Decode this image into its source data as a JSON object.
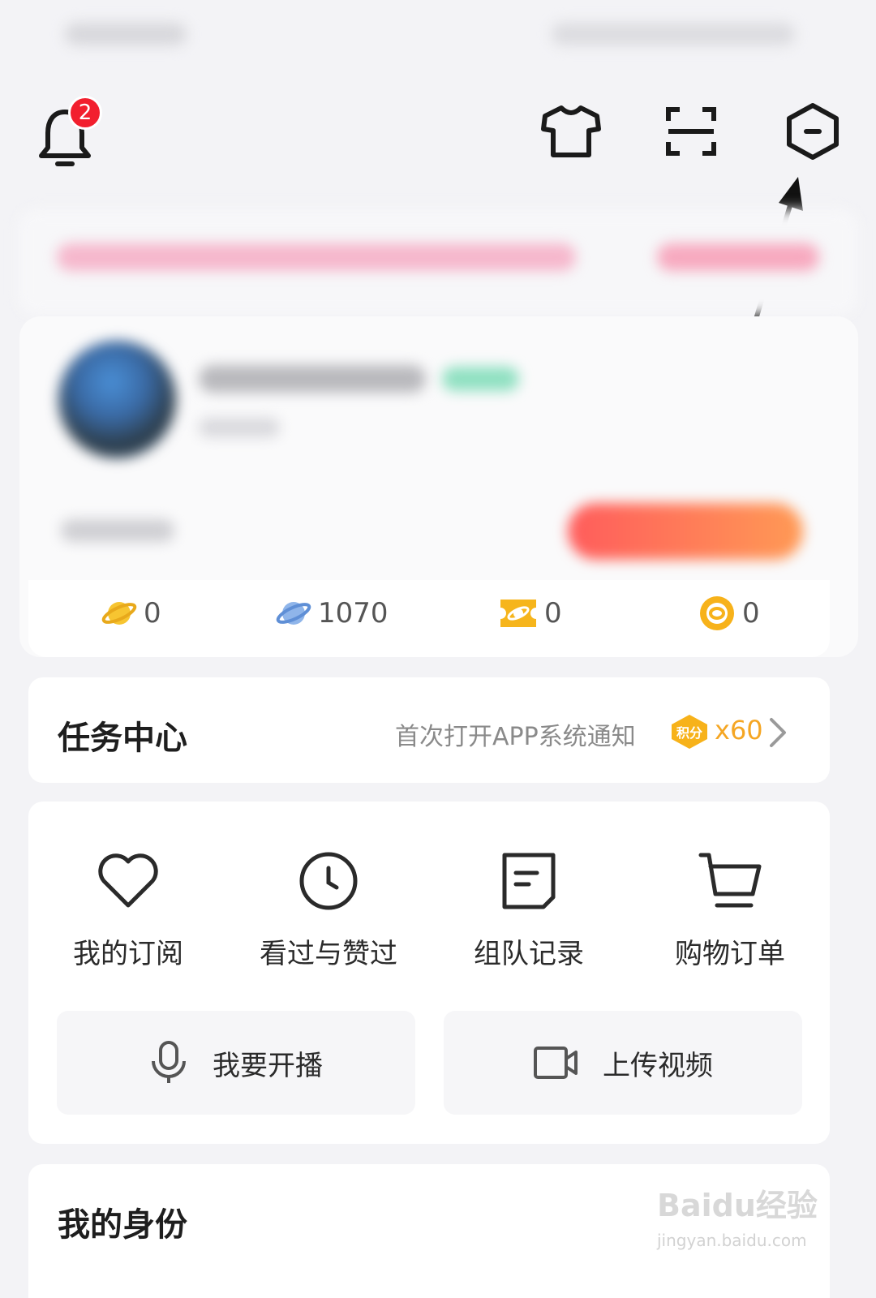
{
  "notifications": {
    "badge_count": "2"
  },
  "stats": [
    {
      "icon": "gold-planet-icon",
      "value": "0"
    },
    {
      "icon": "blue-planet-icon",
      "value": "1070"
    },
    {
      "icon": "planet-ticket-icon",
      "value": "0"
    },
    {
      "icon": "coin-eye-icon",
      "value": "0"
    }
  ],
  "task_center": {
    "title": "任务中心",
    "description": "首次打开APP系统通知",
    "points_badge": "积分",
    "points_value": "x60"
  },
  "menu": {
    "items": [
      {
        "label": "我的订阅",
        "icon": "heart-icon"
      },
      {
        "label": "看过与赞过",
        "icon": "clock-icon"
      },
      {
        "label": "组队记录",
        "icon": "note-icon"
      },
      {
        "label": "购物订单",
        "icon": "cart-icon"
      }
    ],
    "actions": [
      {
        "label": "我要开播",
        "icon": "microphone-icon"
      },
      {
        "label": "上传视频",
        "icon": "video-camera-icon"
      }
    ]
  },
  "identity": {
    "title": "我的身份"
  },
  "watermark": {
    "brand": "Baidu经验",
    "url": "jingyan.baidu.com"
  },
  "colors": {
    "badge_red": "#f21f2e",
    "points_orange": "#f5a623",
    "accent_gradient_start": "#ff5c5c",
    "accent_gradient_end": "#ff9a55"
  }
}
